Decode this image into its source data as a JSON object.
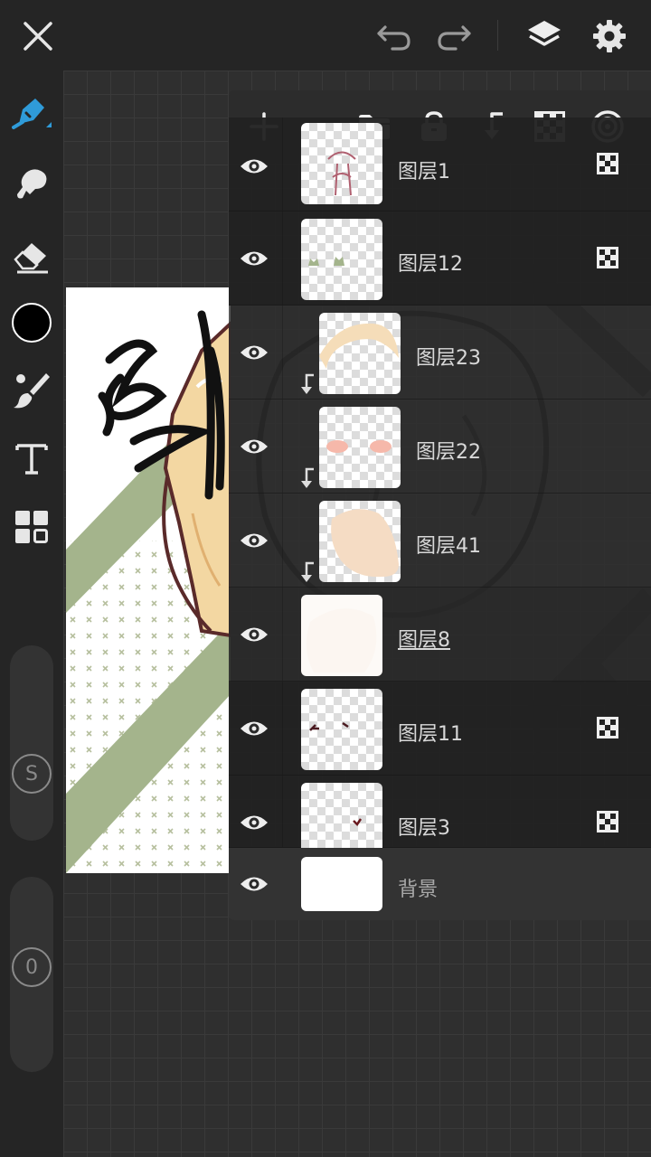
{
  "colors": {
    "accent": "#2f9bd9",
    "brush_color": "#000000",
    "toolbar_bg": "#252525",
    "panel_bg": "#2e2e2e",
    "icon": "#e6e6e6",
    "artwork_green": "#a4b48c"
  },
  "topbar": {
    "icons": [
      "close-icon",
      "undo-icon",
      "redo-icon",
      "layers-icon",
      "settings-icon"
    ]
  },
  "toolbar": {
    "tools": [
      "pen-icon",
      "smudge-icon",
      "eraser-icon",
      "color-swatch",
      "brush-icon",
      "text-icon",
      "gallery-icon"
    ],
    "size_slider_label": "S",
    "opacity_slider_label": "0"
  },
  "layer_panel": {
    "toolbar_icons": [
      "add-layer-icon",
      "folder-icon",
      "lock-icon",
      "clip-icon",
      "alpha-lock-icon",
      "blend-mode-icon"
    ],
    "layers": [
      {
        "name": "图层1",
        "clipped": false,
        "alpha_locked": true,
        "selected": false
      },
      {
        "name": "图层12",
        "clipped": false,
        "alpha_locked": true,
        "selected": false
      },
      {
        "name": "图层23",
        "clipped": true,
        "alpha_locked": false,
        "selected": false
      },
      {
        "name": "图层22",
        "clipped": true,
        "alpha_locked": false,
        "selected": false
      },
      {
        "name": "图层41",
        "clipped": true,
        "alpha_locked": false,
        "selected": false
      },
      {
        "name": "图层8",
        "clipped": false,
        "alpha_locked": false,
        "selected": true
      },
      {
        "name": "图层11",
        "clipped": false,
        "alpha_locked": true,
        "selected": false
      },
      {
        "name": "图层3",
        "clipped": false,
        "alpha_locked": true,
        "selected": false
      },
      {
        "name": "背景",
        "clipped": false,
        "alpha_locked": false,
        "selected": false
      }
    ]
  }
}
